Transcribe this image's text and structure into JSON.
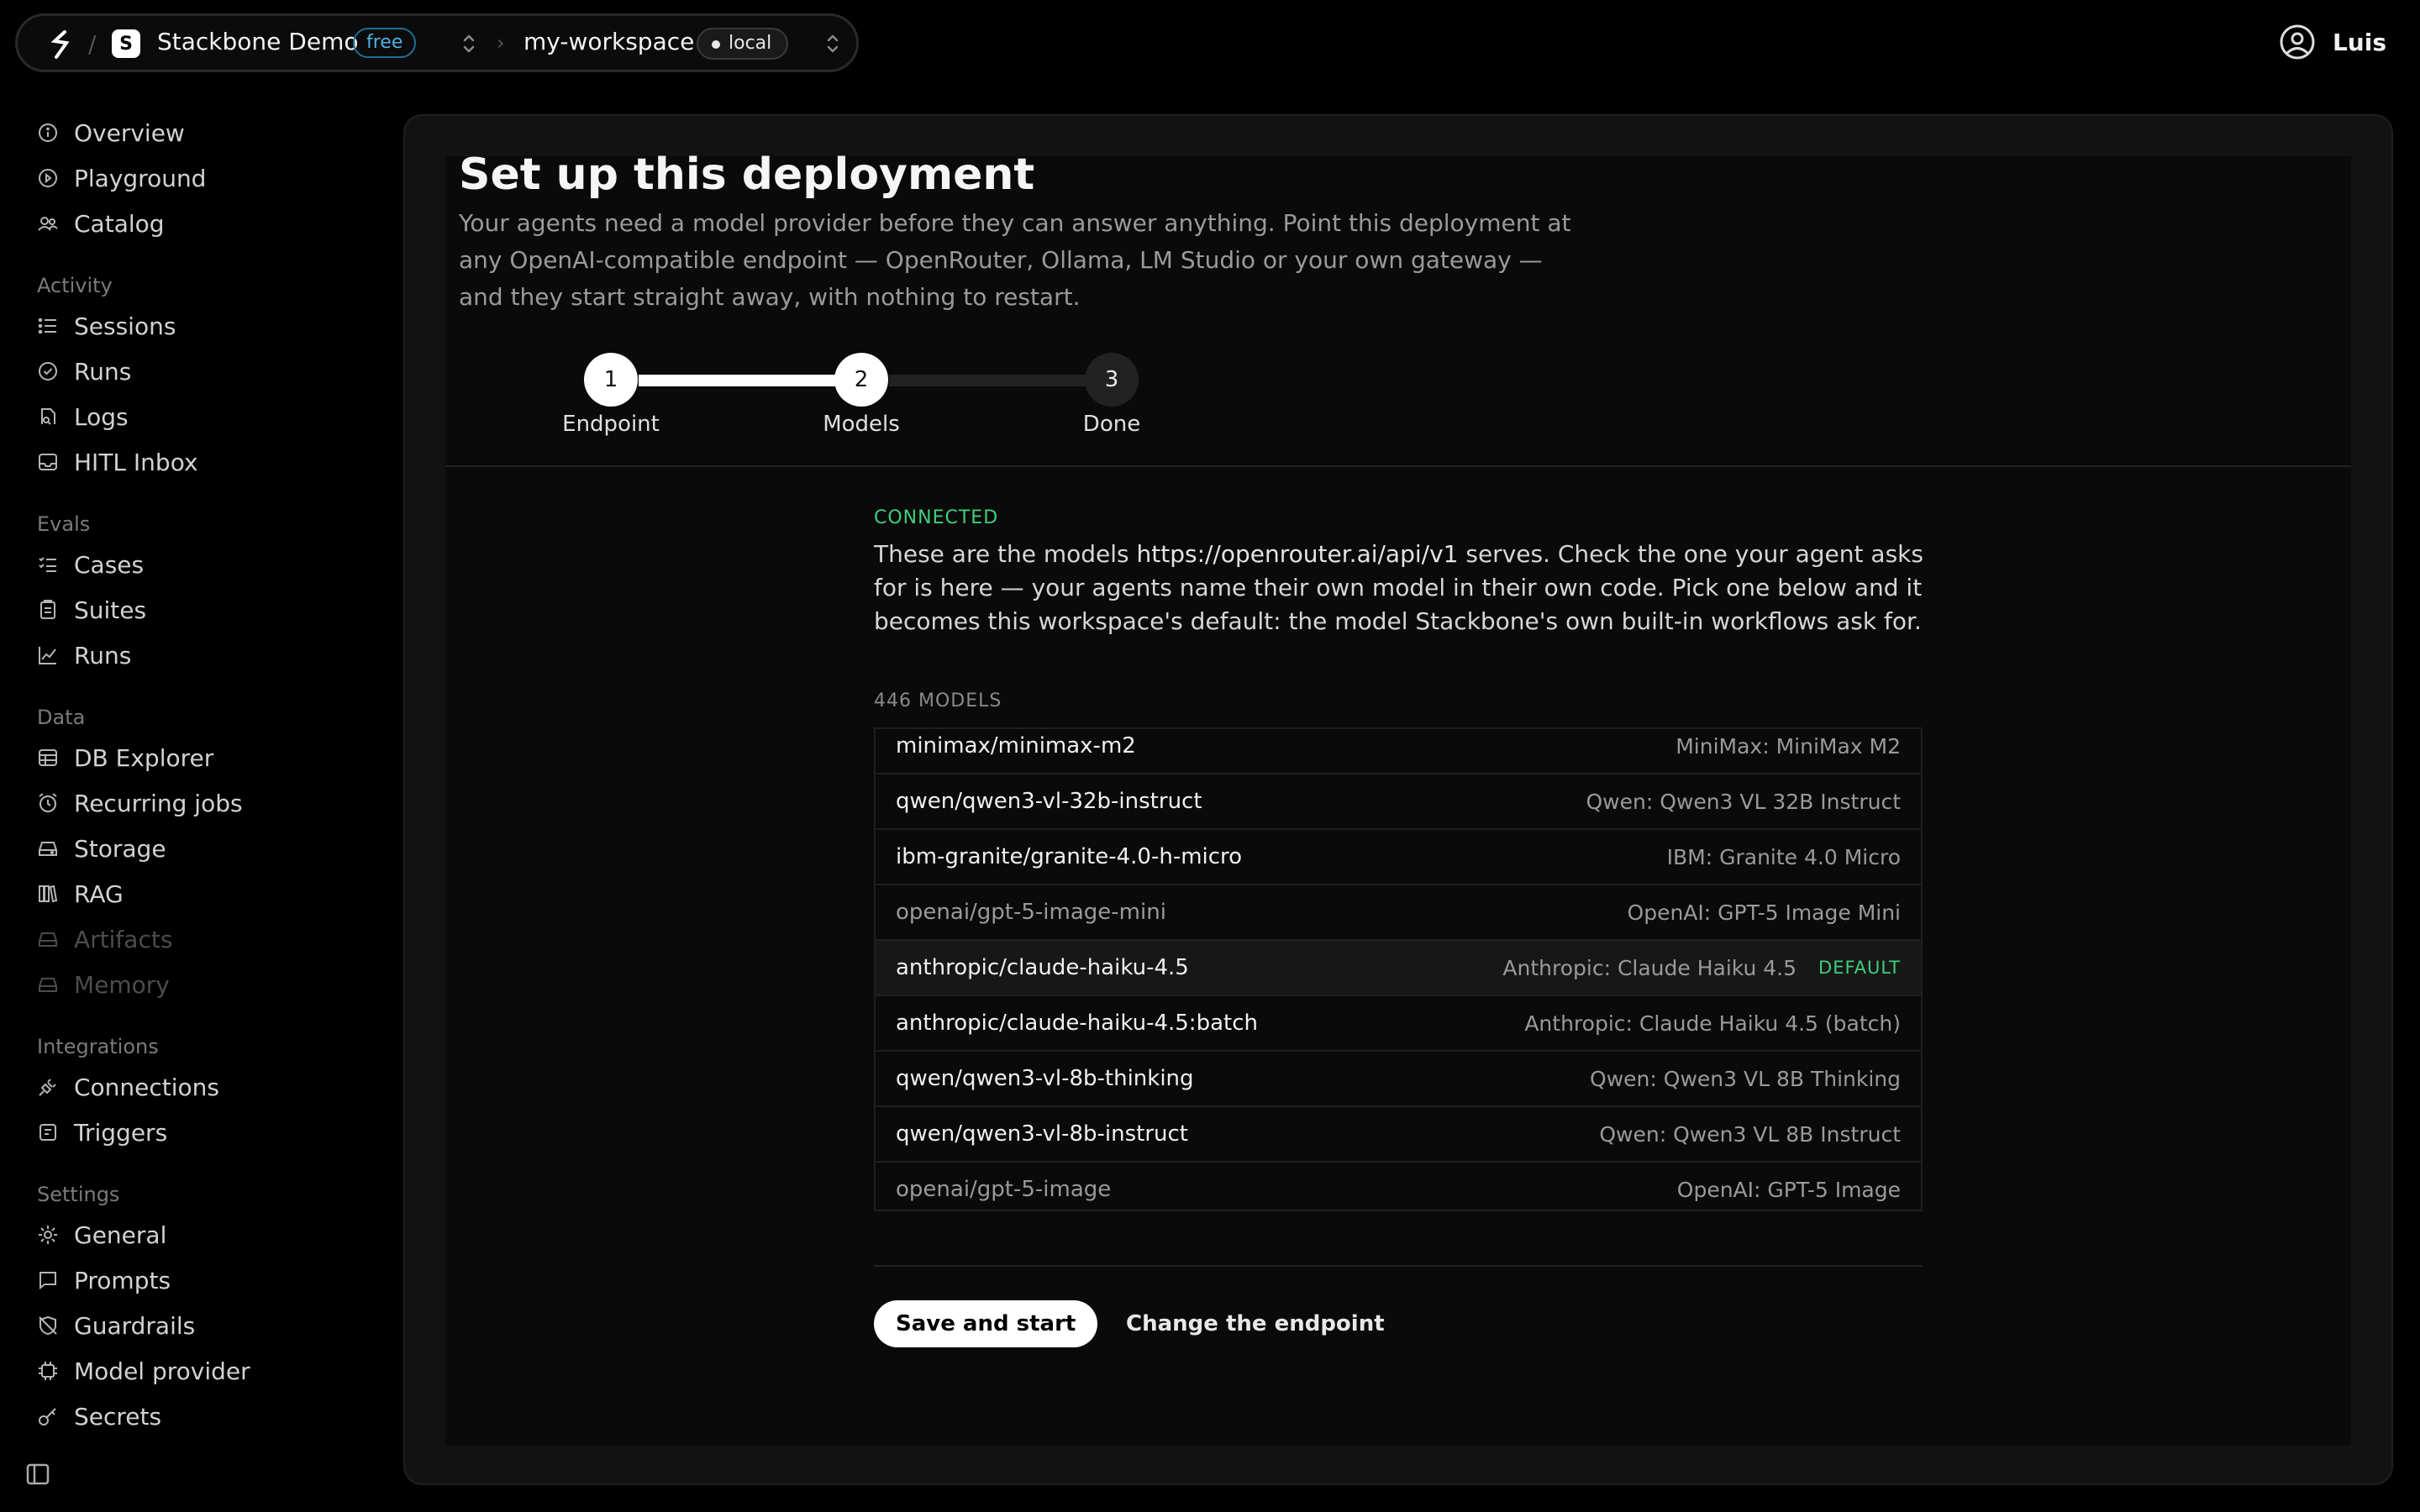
{
  "topbar": {
    "workspace_initial": "S",
    "workspace_name": "Stackbone Demo",
    "plan_badge": "free",
    "project_name": "my-workspace",
    "environment": "local",
    "user_name": "Luis"
  },
  "sidebar": {
    "top_items": [
      "Overview",
      "Playground",
      "Catalog"
    ],
    "sections": {
      "activity": {
        "title": "Activity",
        "items": [
          "Sessions",
          "Runs",
          "Logs",
          "HITL Inbox"
        ]
      },
      "evals": {
        "title": "Evals",
        "items": [
          "Cases",
          "Suites",
          "Runs"
        ]
      },
      "data": {
        "title": "Data",
        "items": [
          "DB Explorer",
          "Recurring jobs",
          "Storage",
          "RAG",
          "Artifacts",
          "Memory"
        ]
      },
      "integrations": {
        "title": "Integrations",
        "items": [
          "Connections",
          "Triggers"
        ]
      },
      "settings": {
        "title": "Settings",
        "items": [
          "General",
          "Prompts",
          "Guardrails",
          "Model provider",
          "Secrets"
        ]
      }
    }
  },
  "page": {
    "title": "Set up this deployment",
    "description": "Your agents need a model provider before they can answer anything. Point this deployment at any OpenAI-compatible endpoint — OpenRouter, Ollama, LM Studio or your own gateway — and they start straight away, with nothing to restart."
  },
  "stepper": {
    "steps": [
      {
        "number": "1",
        "label": "Endpoint",
        "state": "done"
      },
      {
        "number": "2",
        "label": "Models",
        "state": "active"
      },
      {
        "number": "3",
        "label": "Done",
        "state": "pending"
      }
    ]
  },
  "models_step": {
    "status": "CONNECTED",
    "intro_before_url": "These are the models ",
    "endpoint_url": "https://openrouter.ai/api/v1",
    "intro_after_url": " serves. Check the one your agent asks for is here — your agents name their own model in their own code. Pick one below and it becomes this workspace's default: the model Stackbone's own built-in workflows ask for.",
    "count_label": "446 MODELS",
    "default_badge": "DEFAULT",
    "models": [
      {
        "id": "minimax/minimax-m2",
        "name": "MiniMax: MiniMax M2",
        "dim": false,
        "default": false
      },
      {
        "id": "qwen/qwen3-vl-32b-instruct",
        "name": "Qwen: Qwen3 VL 32B Instruct",
        "dim": false,
        "default": false
      },
      {
        "id": "ibm-granite/granite-4.0-h-micro",
        "name": "IBM: Granite 4.0 Micro",
        "dim": false,
        "default": false
      },
      {
        "id": "openai/gpt-5-image-mini",
        "name": "OpenAI: GPT-5 Image Mini",
        "dim": true,
        "default": false
      },
      {
        "id": "anthropic/claude-haiku-4.5",
        "name": "Anthropic: Claude Haiku 4.5",
        "dim": false,
        "default": true
      },
      {
        "id": "anthropic/claude-haiku-4.5:batch",
        "name": "Anthropic: Claude Haiku 4.5 (batch)",
        "dim": false,
        "default": false
      },
      {
        "id": "qwen/qwen3-vl-8b-thinking",
        "name": "Qwen: Qwen3 VL 8B Thinking",
        "dim": false,
        "default": false
      },
      {
        "id": "qwen/qwen3-vl-8b-instruct",
        "name": "Qwen: Qwen3 VL 8B Instruct",
        "dim": false,
        "default": false
      },
      {
        "id": "openai/gpt-5-image",
        "name": "OpenAI: GPT-5 Image",
        "dim": true,
        "default": false
      }
    ]
  },
  "actions": {
    "primary": "Save and start",
    "secondary": "Change the endpoint"
  }
}
